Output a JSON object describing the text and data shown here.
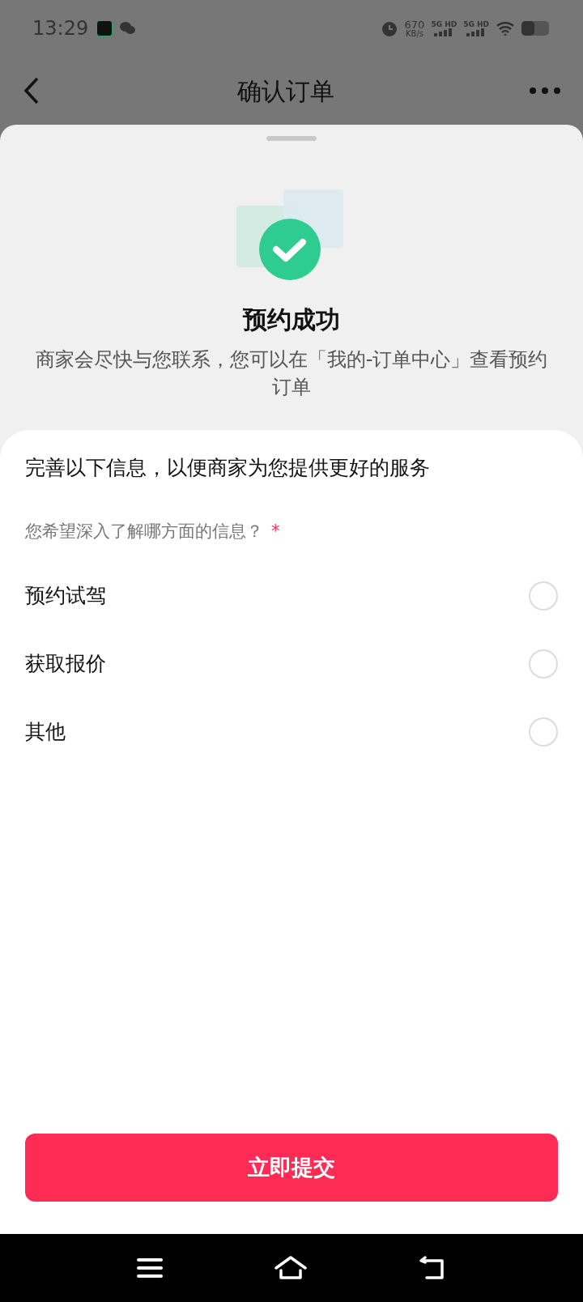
{
  "status_bar": {
    "time": "13:29",
    "net_speed": "670",
    "net_unit": "KB/s",
    "sim_1": "5G HD",
    "sim_2": "5G HD"
  },
  "header": {
    "title": "确认订单"
  },
  "success": {
    "title": "预约成功",
    "message": "商家会尽快与您联系，您可以在「我的-订单中心」查看预约订单"
  },
  "form": {
    "heading": "完善以下信息，以便商家为您提供更好的服务",
    "question": "您希望深入了解哪方面的信息？",
    "required_mark": "*",
    "options": [
      {
        "label": "预约试驾",
        "selected": false
      },
      {
        "label": "获取报价",
        "selected": false
      },
      {
        "label": "其他",
        "selected": false
      }
    ]
  },
  "submit": {
    "label": "立即提交"
  }
}
